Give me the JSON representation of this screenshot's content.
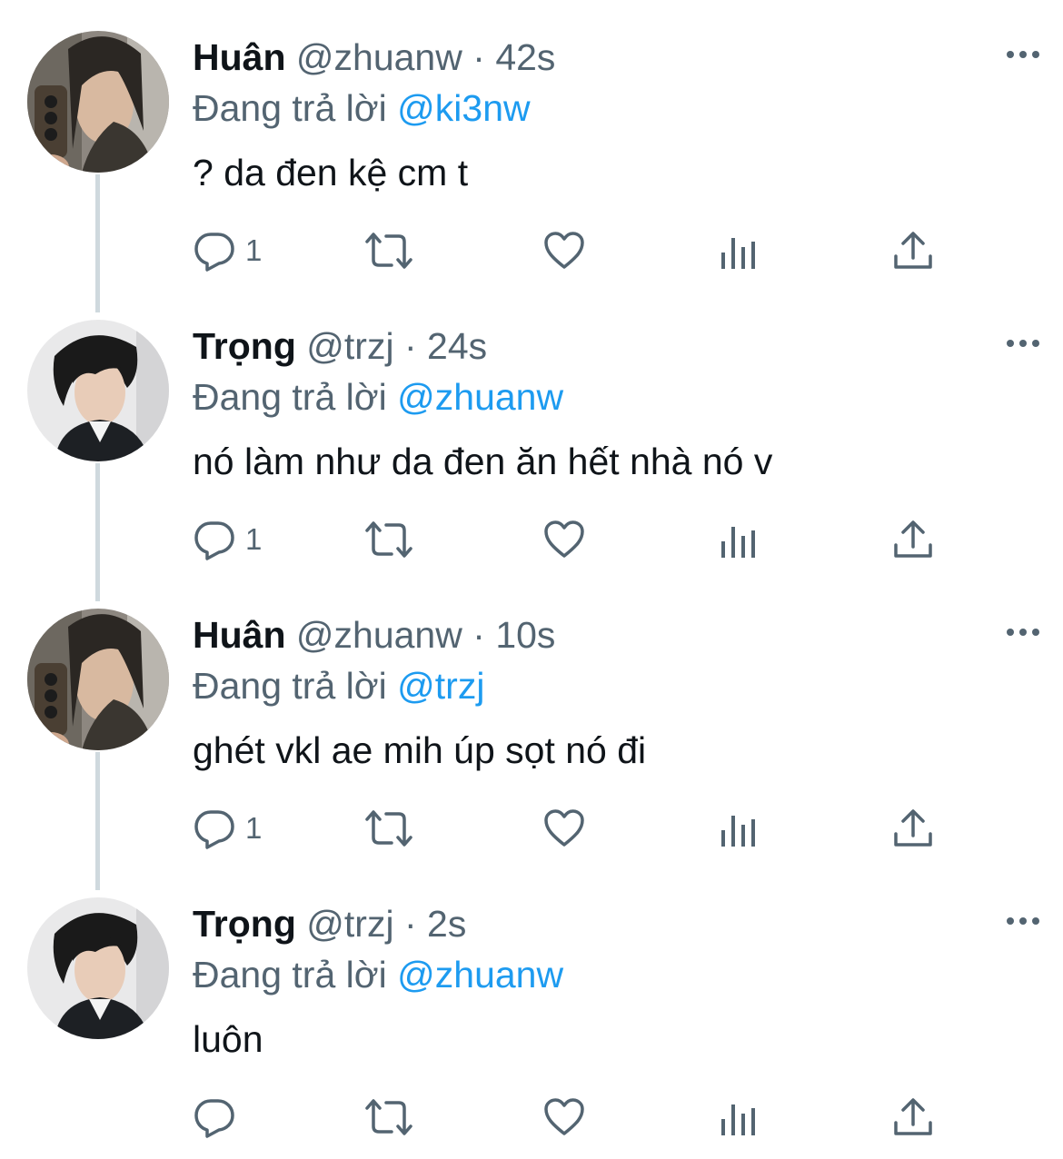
{
  "tweets": [
    {
      "name": "Huân",
      "handle": "@zhuanw",
      "separator": "·",
      "time": "42s",
      "reply_prefix": "Đang trả lời",
      "reply_to": "@ki3nw",
      "text": "? da đen kệ cm t",
      "reply_count": "1",
      "avatar": "huan"
    },
    {
      "name": "Trọng",
      "handle": "@trzj",
      "separator": "·",
      "time": "24s",
      "reply_prefix": "Đang trả lời",
      "reply_to": "@zhuanw",
      "text": "nó làm như da đen ăn hết nhà nó v",
      "reply_count": "1",
      "avatar": "trong"
    },
    {
      "name": "Huân",
      "handle": "@zhuanw",
      "separator": "·",
      "time": "10s",
      "reply_prefix": "Đang trả lời",
      "reply_to": "@trzj",
      "text": "ghét vkl ae mih úp sọt nó đi",
      "reply_count": "1",
      "avatar": "huan"
    },
    {
      "name": "Trọng",
      "handle": "@trzj",
      "separator": "·",
      "time": "2s",
      "reply_prefix": "Đang trả lời",
      "reply_to": "@zhuanw",
      "text": "luôn",
      "reply_count": "",
      "avatar": "trong"
    }
  ],
  "icons": {
    "more": "more-horizontal-icon",
    "reply": "reply-icon",
    "retweet": "retweet-icon",
    "like": "heart-icon",
    "views": "views-icon",
    "share": "share-icon"
  },
  "colors": {
    "text_primary": "#0f1419",
    "text_secondary": "#536471",
    "link": "#1d9bf0",
    "thread_line": "#cfd9de"
  }
}
